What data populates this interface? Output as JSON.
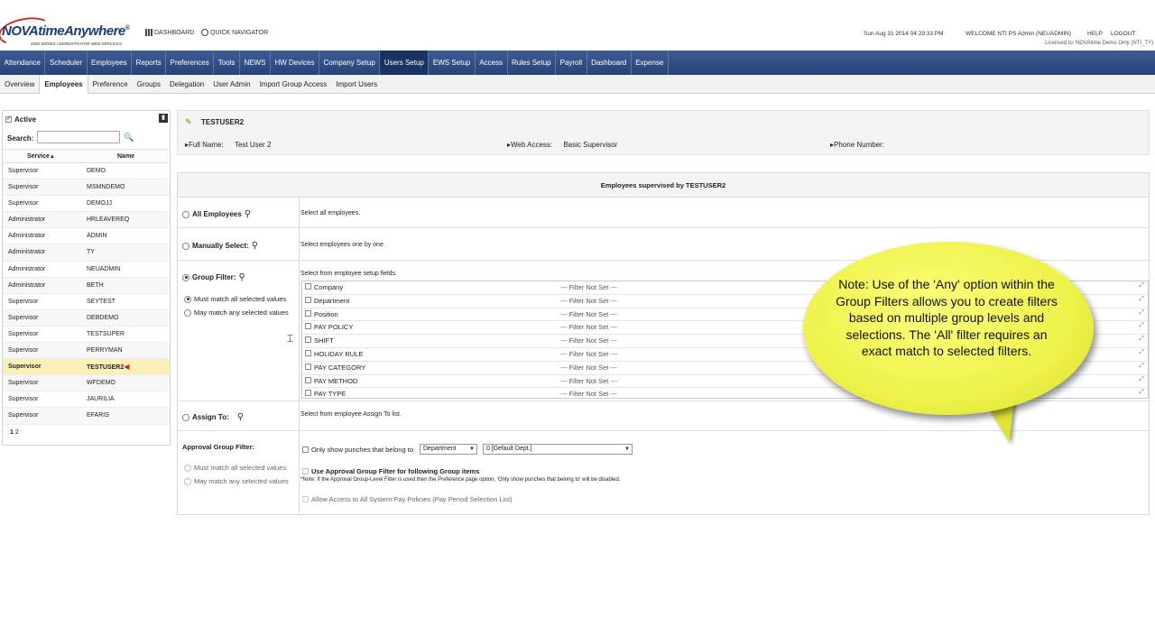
{
  "header": {
    "logo_text": "NOVAtimeAnywhere",
    "logo_reg": "®",
    "logo_sub": "4000 SERIES ADMINISTRATOR WEB SERVICES",
    "dashboard_link": "DASHBOARD",
    "quick_nav_link": "QUICK NAVIGATOR",
    "datetime": "Sun Aug 31 2014 04:29:33 PM",
    "welcome": "WELCOME NTI PS Admin (NEUADMIN)",
    "help": "HELP",
    "logout": "LOGOUT",
    "licensed": "Licensed to: NOVAtime Demo Only (NTI_TY)"
  },
  "main_nav": [
    "Attendance",
    "Scheduler",
    "Employees",
    "Reports",
    "Preferences",
    "Tools",
    "NEWS",
    "HW Devices",
    "Company Setup",
    "Users Setup",
    "EWS Setup",
    "Access",
    "Rules Setup",
    "Payroll",
    "Dashboard",
    "Expense"
  ],
  "main_nav_active": "Users Setup",
  "sub_nav": [
    "Overview",
    "Employees",
    "Preference",
    "Groups",
    "Delegation",
    "User Admin",
    "Import Group Access",
    "Import Users"
  ],
  "sub_nav_active": "Employees",
  "left_panel": {
    "active_label": "Active",
    "search_label": "Search:",
    "search_value": "",
    "col_service": "Service",
    "col_service_sort": "▲",
    "col_name": "Name",
    "rows": [
      {
        "service": "Supervisor",
        "name": "DEMO"
      },
      {
        "service": "Supervisor",
        "name": "MSMNDEMO"
      },
      {
        "service": "Supervisor",
        "name": "DEMOJJ"
      },
      {
        "service": "Administrator",
        "name": "HRLEAVEREQ"
      },
      {
        "service": "Administrator",
        "name": "ADMIN"
      },
      {
        "service": "Administrator",
        "name": "TY"
      },
      {
        "service": "Administrator",
        "name": "NEUADMIN"
      },
      {
        "service": "Administrator",
        "name": "BETH"
      },
      {
        "service": "Supervisor",
        "name": "SEYTEST"
      },
      {
        "service": "Supervisor",
        "name": "DEBDEMO"
      },
      {
        "service": "Supervisor",
        "name": "TESTSUPER"
      },
      {
        "service": "Supervisor",
        "name": "PERRYMAN"
      },
      {
        "service": "Supervisor",
        "name": "TESTUSER2"
      },
      {
        "service": "Supervisor",
        "name": "WFDEMO"
      },
      {
        "service": "Supervisor",
        "name": "JAURILIA"
      },
      {
        "service": "Supervisor",
        "name": "EFARIS"
      }
    ],
    "selected_index": 12,
    "pager_current": "1",
    "pager_other": "2"
  },
  "user": {
    "username": "TESTUSER2",
    "full_name_label": "Full Name:",
    "full_name": "Test User 2",
    "web_access_label": "Web Access:",
    "web_access": "Basic Supervisor",
    "phone_label": "Phone Number:",
    "phone": ""
  },
  "supervised": {
    "title": "Employees supervised by TESTUSER2",
    "all_employees": "All Employees",
    "all_employees_desc": "Select all employees.",
    "manually_select": "Manually Select:",
    "manually_select_desc": "Select employees one by one.",
    "group_filter": "Group Filter:",
    "group_filter_desc": "Select from employee setup fields.",
    "must_match": "Must match all selected values",
    "may_match": "May match any selected values",
    "filter_value": "--- Filter Not Set ---",
    "filters": [
      "Company",
      "Department",
      "Position",
      "PAY POLICY",
      "SHIFT",
      "HOLIDAY RULE",
      "PAY CATEGORY",
      "PAY METHOD",
      "PAY TYPE"
    ],
    "assign_to": "Assign To:",
    "assign_to_desc": "Select from employee Assign To list.",
    "approval_label": "Approval Group Filter:",
    "approval_must": "Must match all selected values",
    "approval_may": "May match any selected values",
    "only_show": "Only show punches that belong to",
    "dept_select": "Department",
    "dept_value": "0 [Default Dept.]",
    "use_approval": "Use Approval Group Filter for following Group items",
    "note": "*Note: If the Approval Group-Level Filter is used then the Preference page option, 'Only show punches that belong to' will be disabled.",
    "allow_access": "Allow Access to All System Pay Policies (Pay Period Selection List)"
  },
  "callout": {
    "text": "Note:  Use of the 'Any' option within the Group Filters allows you to create filters based on multiple group levels and selections.  The 'All' filter requires an exact match to selected filters."
  },
  "colors": {
    "nav_bg": "#2f4d85",
    "nav_active": "#1a3462",
    "selected_row": "#fbf0b8",
    "callout": "#eef24a"
  }
}
